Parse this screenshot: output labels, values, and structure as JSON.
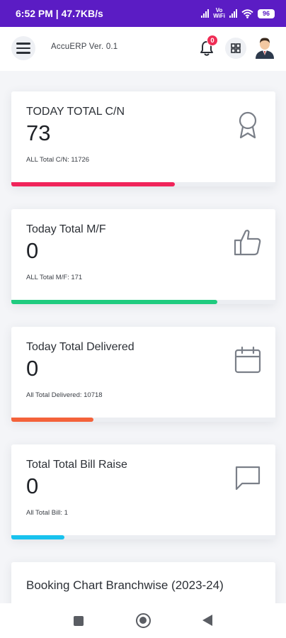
{
  "status_bar": {
    "time_speed": "6:52 PM | 47.7KB/s",
    "vowifi_top": "Vo",
    "vowifi_bottom": "WiFi",
    "battery": "96"
  },
  "header": {
    "app_title": "AccuERP Ver. 0.1",
    "notification_count": "0",
    "icons": {
      "menu": "hamburger-menu-icon",
      "bell": "bell-icon",
      "apps": "grid-icon",
      "avatar": "user-avatar"
    }
  },
  "cards": [
    {
      "title": "TODAY TOTAL C/N",
      "value": "73",
      "subtitle": "ALL Total C/N: 11726",
      "icon": "award-icon",
      "bar_color": "#f0245a",
      "bar_fraction": 0.62
    },
    {
      "title": "Today Total M/F",
      "value": "0",
      "subtitle": "ALL Total M/F: 171",
      "icon": "thumbs-up-icon",
      "bar_color": "#1fcb7f",
      "bar_fraction": 0.78
    },
    {
      "title": "Today Total Delivered",
      "value": "0",
      "subtitle": "All Total Delivered: 10718",
      "icon": "calendar-icon",
      "bar_color": "#f4623a",
      "bar_fraction": 0.31
    },
    {
      "title": "Total Total Bill Raise",
      "value": "0",
      "subtitle": "All Total Bill: 1",
      "icon": "message-icon",
      "bar_color": "#19c2ee",
      "bar_fraction": 0.2
    }
  ],
  "chart_section": {
    "title": "Booking Chart Branchwise (2023-24)"
  },
  "colors": {
    "status_bar": "#5b1cc4",
    "badge": "#ef2d55",
    "icon_stroke": "#7a7f88"
  }
}
